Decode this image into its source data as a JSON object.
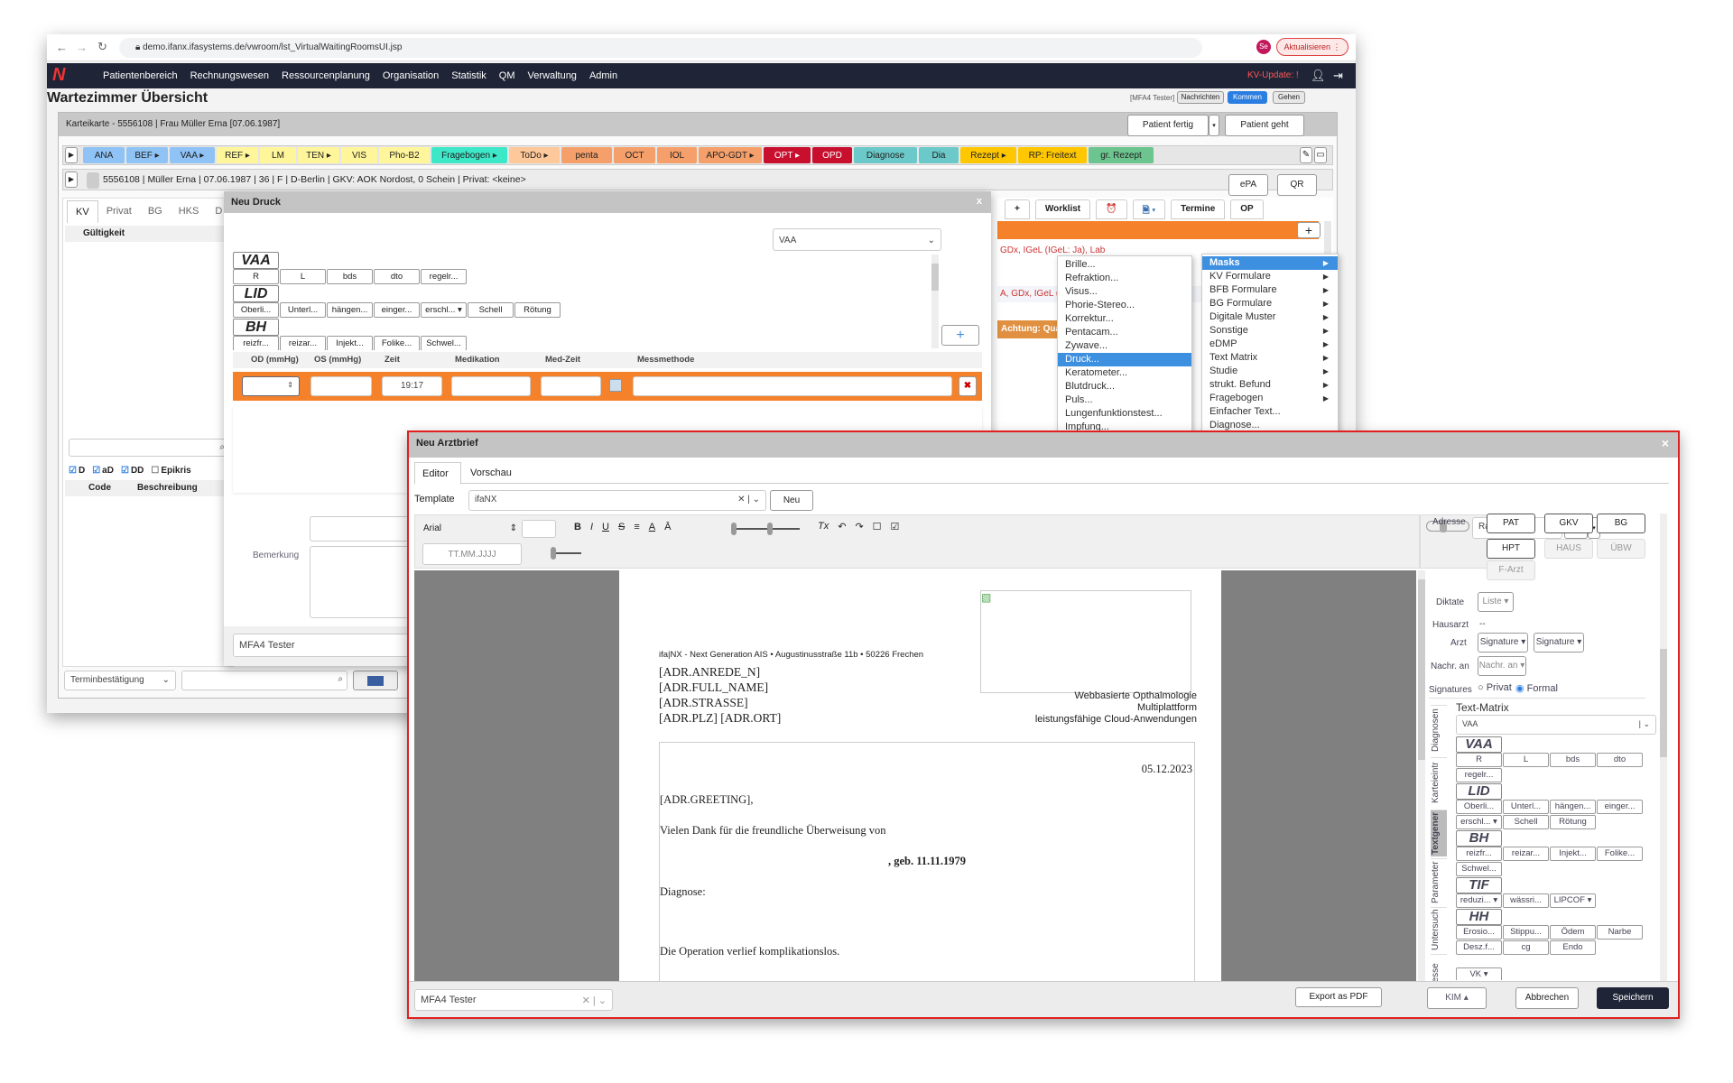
{
  "browser": {
    "url": "demo.ifanx.ifasystems.de/vwroom/lst_VirtualWaitingRoomsUI.jsp",
    "update": "Aktualisieren",
    "avatar": "Se"
  },
  "nav": {
    "items": [
      "Patientenbereich",
      "Rechnungswesen",
      "Ressourcenplanung",
      "Organisation",
      "Statistik",
      "QM",
      "Verwaltung",
      "Admin"
    ],
    "kv_update": "KV-Update: !"
  },
  "page": {
    "title": "Wartezimmer Übersicht",
    "user": "[MFA4 Tester]",
    "nachrichten": "Nachrichten",
    "kommen": "Kommen",
    "gehen": "Gehen"
  },
  "karteikarte": {
    "title": "Karteikarte - 5556108 | Frau Müller Erna [07.06.1987]",
    "patient_fertig": "Patient fertig",
    "patient_geht": "Patient geht"
  },
  "toolbar": [
    {
      "label": "ANA",
      "color": "#8fc3f5"
    },
    {
      "label": "BEF ▸",
      "color": "#8fc3f5"
    },
    {
      "label": "VAA ▸",
      "color": "#8fc3f5"
    },
    {
      "label": "REF ▸",
      "color": "#fff59a"
    },
    {
      "label": "LM",
      "color": "#fff59a"
    },
    {
      "label": "TEN ▸",
      "color": "#fff59a"
    },
    {
      "label": "VIS",
      "color": "#fff59a"
    },
    {
      "label": "Pho-B2",
      "color": "#fff59a"
    },
    {
      "label": "Fragebogen ▸",
      "color": "#3de8c8"
    },
    {
      "label": "ToDo ▸",
      "color": "#ffc89a"
    },
    {
      "label": "penta",
      "color": "#f5a06a"
    },
    {
      "label": "OCT",
      "color": "#f5a06a"
    },
    {
      "label": "IOL",
      "color": "#f5a06a"
    },
    {
      "label": "APO-GDT ▸",
      "color": "#f5a06a"
    },
    {
      "label": "OPT ▸",
      "color": "#c8102e"
    },
    {
      "label": "OPD",
      "color": "#c8102e"
    },
    {
      "label": "Diagnose",
      "color": "#6cc9c9"
    },
    {
      "label": "Dia",
      "color": "#6cc9c9"
    },
    {
      "label": "Rezept ▸",
      "color": "#ffc700"
    },
    {
      "label": "RP: Freitext",
      "color": "#ffc700"
    },
    {
      "label": "gr. Rezept",
      "color": "#6cc48f"
    }
  ],
  "patient": {
    "info": "5556108 | Müller Erna | 07.06.1987 | 36 | F | D-Berlin | GKV: AOK Nordost, 0 Schein | Privat: <keine>",
    "epa": "ePA",
    "qr": "QR"
  },
  "left": {
    "tabs": [
      "KV",
      "Privat",
      "BG",
      "HKS",
      "D"
    ],
    "gueltigkeit": "Gültigkeit",
    "checks": [
      {
        "label": "D",
        "checked": true
      },
      {
        "label": "aD",
        "checked": true
      },
      {
        "label": "DD",
        "checked": true
      },
      {
        "label": "Epikris",
        "checked": false
      }
    ],
    "code": "Code",
    "beschreibung": "Beschreibung",
    "termin": "Terminbestätigung"
  },
  "right_bg": {
    "tabs": [
      "+",
      "Worklist",
      "alarm-clock",
      "document",
      "Termine",
      "OP"
    ],
    "line1": "GDx, IGeL (IGeL: Ja), Lab",
    "line2": "A, GDx, IGeL (",
    "warning": "Achtung: Qua"
  },
  "context_menu": {
    "items": [
      "Brille...",
      "Refraktion...",
      "Visus...",
      "Phorie-Stereo...",
      "Korrektur...",
      "Pentacam...",
      "Zywave...",
      "Druck...",
      "Keratometer...",
      "Blutdruck...",
      "Puls...",
      "Lungenfunktionstest...",
      "Impfung..."
    ],
    "selected": "Druck..."
  },
  "submenu": {
    "items": [
      {
        "label": "Masks",
        "arrow": true
      },
      {
        "label": "KV Formulare",
        "arrow": true
      },
      {
        "label": "BFB Formulare",
        "arrow": true
      },
      {
        "label": "BG Formulare",
        "arrow": true
      },
      {
        "label": "Digitale Muster",
        "arrow": true
      },
      {
        "label": "Sonstige",
        "arrow": true
      },
      {
        "label": "eDMP",
        "arrow": true
      },
      {
        "label": "Text Matrix",
        "arrow": true
      },
      {
        "label": "Studie",
        "arrow": true
      },
      {
        "label": "strukt. Befund",
        "arrow": true
      },
      {
        "label": "Fragebogen",
        "arrow": true
      },
      {
        "label": "Einfacher Text...",
        "arrow": false
      },
      {
        "label": "Diagnose...",
        "arrow": false
      }
    ],
    "selected": "Masks"
  },
  "druck": {
    "title": "Neu Druck",
    "close": "x",
    "select": "VAA",
    "matrix": [
      {
        "heading": "VAA",
        "buttons": [
          "R",
          "L",
          "bds",
          "dto",
          "regelr..."
        ]
      },
      {
        "heading": "LID",
        "buttons": [
          "Oberli...",
          "Unterl...",
          "hängen...",
          "einger...",
          "erschl... ▾",
          "Schell",
          "Rötung"
        ]
      },
      {
        "heading": "BH",
        "buttons": [
          "reizfr...",
          "reizar...",
          "Injekt...",
          "Folike...",
          "Schwel..."
        ]
      }
    ],
    "columns": [
      "OD (mmHg)",
      "OS (mmHg)",
      "Zeit",
      "Medikation",
      "Med-Zeit",
      "Messmethode"
    ],
    "zeit": "19:17",
    "bemerkung": "Bemerkung",
    "user": "MFA4 Tester"
  },
  "arztbrief": {
    "title": "Neu Arztbrief",
    "close": "×",
    "tabs": [
      "Editor",
      "Vorschau"
    ],
    "active_tab": "Editor",
    "template_label": "Template",
    "template": "ifaNX",
    "neu": "Neu",
    "font": "Arial",
    "date_placeholder": "TT.MM.JJJJ",
    "margin": "Randlos",
    "letter": {
      "sender": "ifa|NX - Next Generation AIS • Augustinusstraße 11b • 50226 Frechen",
      "address": [
        "[ADR.ANREDE_N]",
        "[ADR.FULL_NAME]",
        "[ADR.STRASSE]",
        "[ADR.PLZ] [ADR.ORT]"
      ],
      "tagline": [
        "Webbasierte Opthalmologie",
        "Multiplattform",
        "leistungsfähige Cloud-Anwendungen"
      ],
      "date": "05.12.2023",
      "greeting": "[ADR.GREETING],",
      "thanks": "Vielen Dank für die freundliche Überweisung von",
      "born": ", geb. 11.11.1979",
      "diagnose": "Diagnose:",
      "operation": "Die Operation verlief komplikationslos."
    },
    "side": {
      "adresse": "Adresse",
      "addr_buttons": [
        {
          "label": "PAT",
          "enabled": true
        },
        {
          "label": "GKV",
          "enabled": true
        },
        {
          "label": "BG",
          "enabled": true
        },
        {
          "label": "HPT",
          "enabled": true
        },
        {
          "label": "HAUS",
          "enabled": false
        },
        {
          "label": "ÜBW",
          "enabled": false
        },
        {
          "label": "F-Arzt",
          "enabled": false
        }
      ],
      "diktate": "Diktate",
      "liste": "Liste ▾",
      "hausarzt": "Hausarzt",
      "hausarzt_val": "--",
      "arzt": "Arzt",
      "signature1": "Signature ▾",
      "signature2": "Signature ▾",
      "nachr": "Nachr. an",
      "nachr_btn": "Nachr. an ▾",
      "signatures": "Signatures",
      "privat": "Privat",
      "formal": "Formal",
      "signature_mode": "Formal",
      "vtabs": [
        "Diagnosen",
        "Karteieintr",
        "Textgener",
        "Parameter",
        "Untersuch",
        "Adresse"
      ],
      "active_vtab": "Textgener",
      "textmatrix": "Text-Matrix",
      "tm_select": "VAA",
      "matrix": [
        {
          "heading": "VAA",
          "buttons": [
            "R",
            "L",
            "bds",
            "dto",
            "regelr..."
          ]
        },
        {
          "heading": "LID",
          "buttons": [
            "Oberli...",
            "Unterl...",
            "hängen...",
            "einger...",
            "erschl... ▾",
            "Schell",
            "Rötung"
          ]
        },
        {
          "heading": "BH",
          "buttons": [
            "reizfr...",
            "reizar...",
            "Injekt...",
            "Folike...",
            "Schwel..."
          ]
        },
        {
          "heading": "TIF",
          "buttons": [
            "reduzi... ▾",
            "wässri...",
            "LIPCOF ▾"
          ]
        },
        {
          "heading": "HH",
          "buttons": [
            "Erosio...",
            "Stippu...",
            "Ödem",
            "Narbe",
            "Desz.f...",
            "cg",
            "Endo"
          ]
        }
      ],
      "vk": "VK ▾"
    },
    "footer": {
      "user": "MFA4 Tester",
      "export": "Export as PDF",
      "kim": "KIM ▴",
      "cancel": "Abbrechen",
      "save": "Speichern"
    }
  },
  "colors": {
    "nav": "#1f2537",
    "orange": "#f5822a",
    "accent": "#3d8fe0",
    "border_red": "#e02020",
    "kommen": "#2a7de1"
  }
}
